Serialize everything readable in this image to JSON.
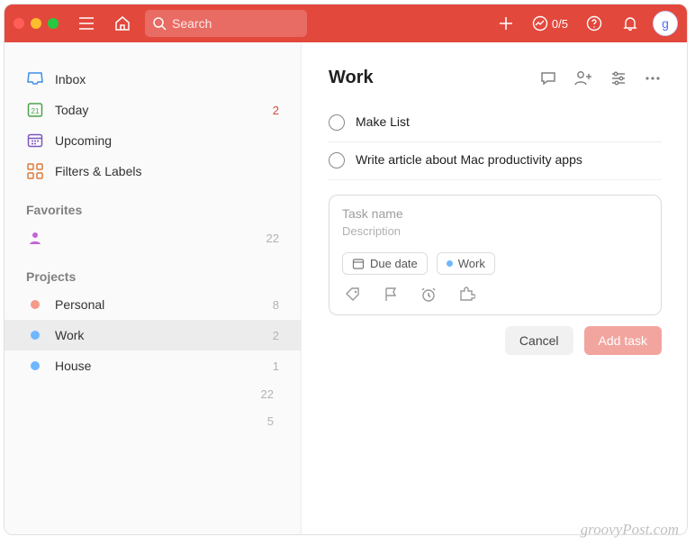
{
  "topbar": {
    "search_placeholder": "Search",
    "progress": "0/5",
    "avatar_initial": "g"
  },
  "sidebar": {
    "nav": [
      {
        "id": "inbox",
        "label": "Inbox",
        "color": "#3d8fe8",
        "count": ""
      },
      {
        "id": "today",
        "label": "Today",
        "color": "#4aa34a",
        "count": "2",
        "count_red": true,
        "date": "21"
      },
      {
        "id": "upcoming",
        "label": "Upcoming",
        "color": "#7d57c1",
        "count": ""
      },
      {
        "id": "filters",
        "label": "Filters & Labels",
        "color": "#e07a3c",
        "count": ""
      }
    ],
    "favorites_title": "Favorites",
    "favorites": [
      {
        "id": "fav-person",
        "label": "",
        "icon": "person",
        "color": "#c264d6",
        "count": "22"
      }
    ],
    "projects_title": "Projects",
    "projects": [
      {
        "id": "personal",
        "label": "Personal",
        "color": "#f49a8a",
        "count": "8"
      },
      {
        "id": "work",
        "label": "Work",
        "color": "#6fb7ff",
        "count": "2",
        "active": true
      },
      {
        "id": "house",
        "label": "House",
        "color": "#6fb7ff",
        "count": "1"
      }
    ],
    "stats": [
      "22",
      "5"
    ]
  },
  "main": {
    "title": "Work",
    "tasks": [
      {
        "text": "Make List"
      },
      {
        "text": "Write article about Mac productivity apps"
      }
    ],
    "add": {
      "taskname_placeholder": "Task name",
      "description_placeholder": "Description",
      "due_label": "Due date",
      "project_label": "Work"
    },
    "buttons": {
      "cancel": "Cancel",
      "add": "Add task"
    }
  },
  "watermark": "groovyPost.com"
}
